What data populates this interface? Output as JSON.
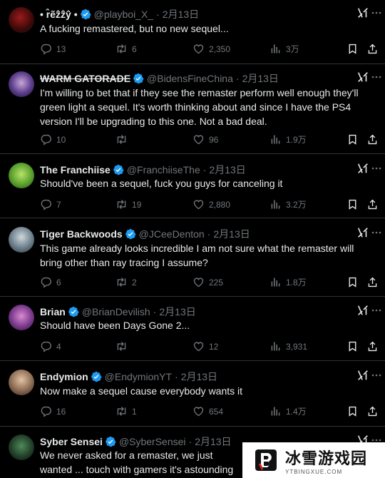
{
  "tweets": [
    {
      "name": "• r̂ẽẑẑŷ •",
      "handle": "@playboi_X_",
      "date": "2月13日",
      "text": "A fucking remastered, but no new sequel...",
      "replies": "13",
      "retweets": "6",
      "likes": "2,350",
      "views": "3万"
    },
    {
      "name": "WARM GATORADE",
      "handle": "@BidensFineChina",
      "date": "2月13日",
      "text": "I'm willing to bet that if they see the remaster perform well enough they'll green light a sequel. It's worth thinking about and since I have the PS4 version I'll be upgrading to this one. Not a bad deal.",
      "replies": "10",
      "retweets": "",
      "likes": "96",
      "views": "1.9万"
    },
    {
      "name": "The Franchiise",
      "handle": "@FranchiiseThe",
      "date": "2月13日",
      "text": "Should've been a sequel, fuck you guys for canceling it",
      "replies": "7",
      "retweets": "19",
      "likes": "2,880",
      "views": "3.2万"
    },
    {
      "name": "Tiger Backwoods",
      "handle": "@JCeeDenton",
      "date": "2月13日",
      "text": "This game already looks incredible I am not sure what the remaster will bring other than ray tracing I assume?",
      "replies": "6",
      "retweets": "2",
      "likes": "225",
      "views": "1.8万"
    },
    {
      "name": "Brian",
      "handle": "@BrianDevilish",
      "date": "2月13日",
      "text": "Should have been Days Gone 2...",
      "replies": "4",
      "retweets": "",
      "likes": "12",
      "views": "3,931"
    },
    {
      "name": "Endymion",
      "handle": "@EndymionYT",
      "date": "2月13日",
      "text": "Now make a sequel cause everybody wants it",
      "replies": "16",
      "retweets": "1",
      "likes": "654",
      "views": "1.4万"
    },
    {
      "name": "Syber Sensei",
      "handle": "@SyberSensei",
      "date": "2月13日",
      "text": "We never asked for a remaster, we just wanted ... touch with gamers it's astounding",
      "replies": "",
      "retweets": "",
      "likes": "",
      "views": ""
    }
  ],
  "separator": "·",
  "colors": {
    "verified": "#1d9bf0",
    "muted": "#71767b",
    "text": "#e7e9ea",
    "divider": "#2f3336"
  },
  "watermark": {
    "title": "冰雪游戏园",
    "url": "YTBINGXUE.COM"
  }
}
